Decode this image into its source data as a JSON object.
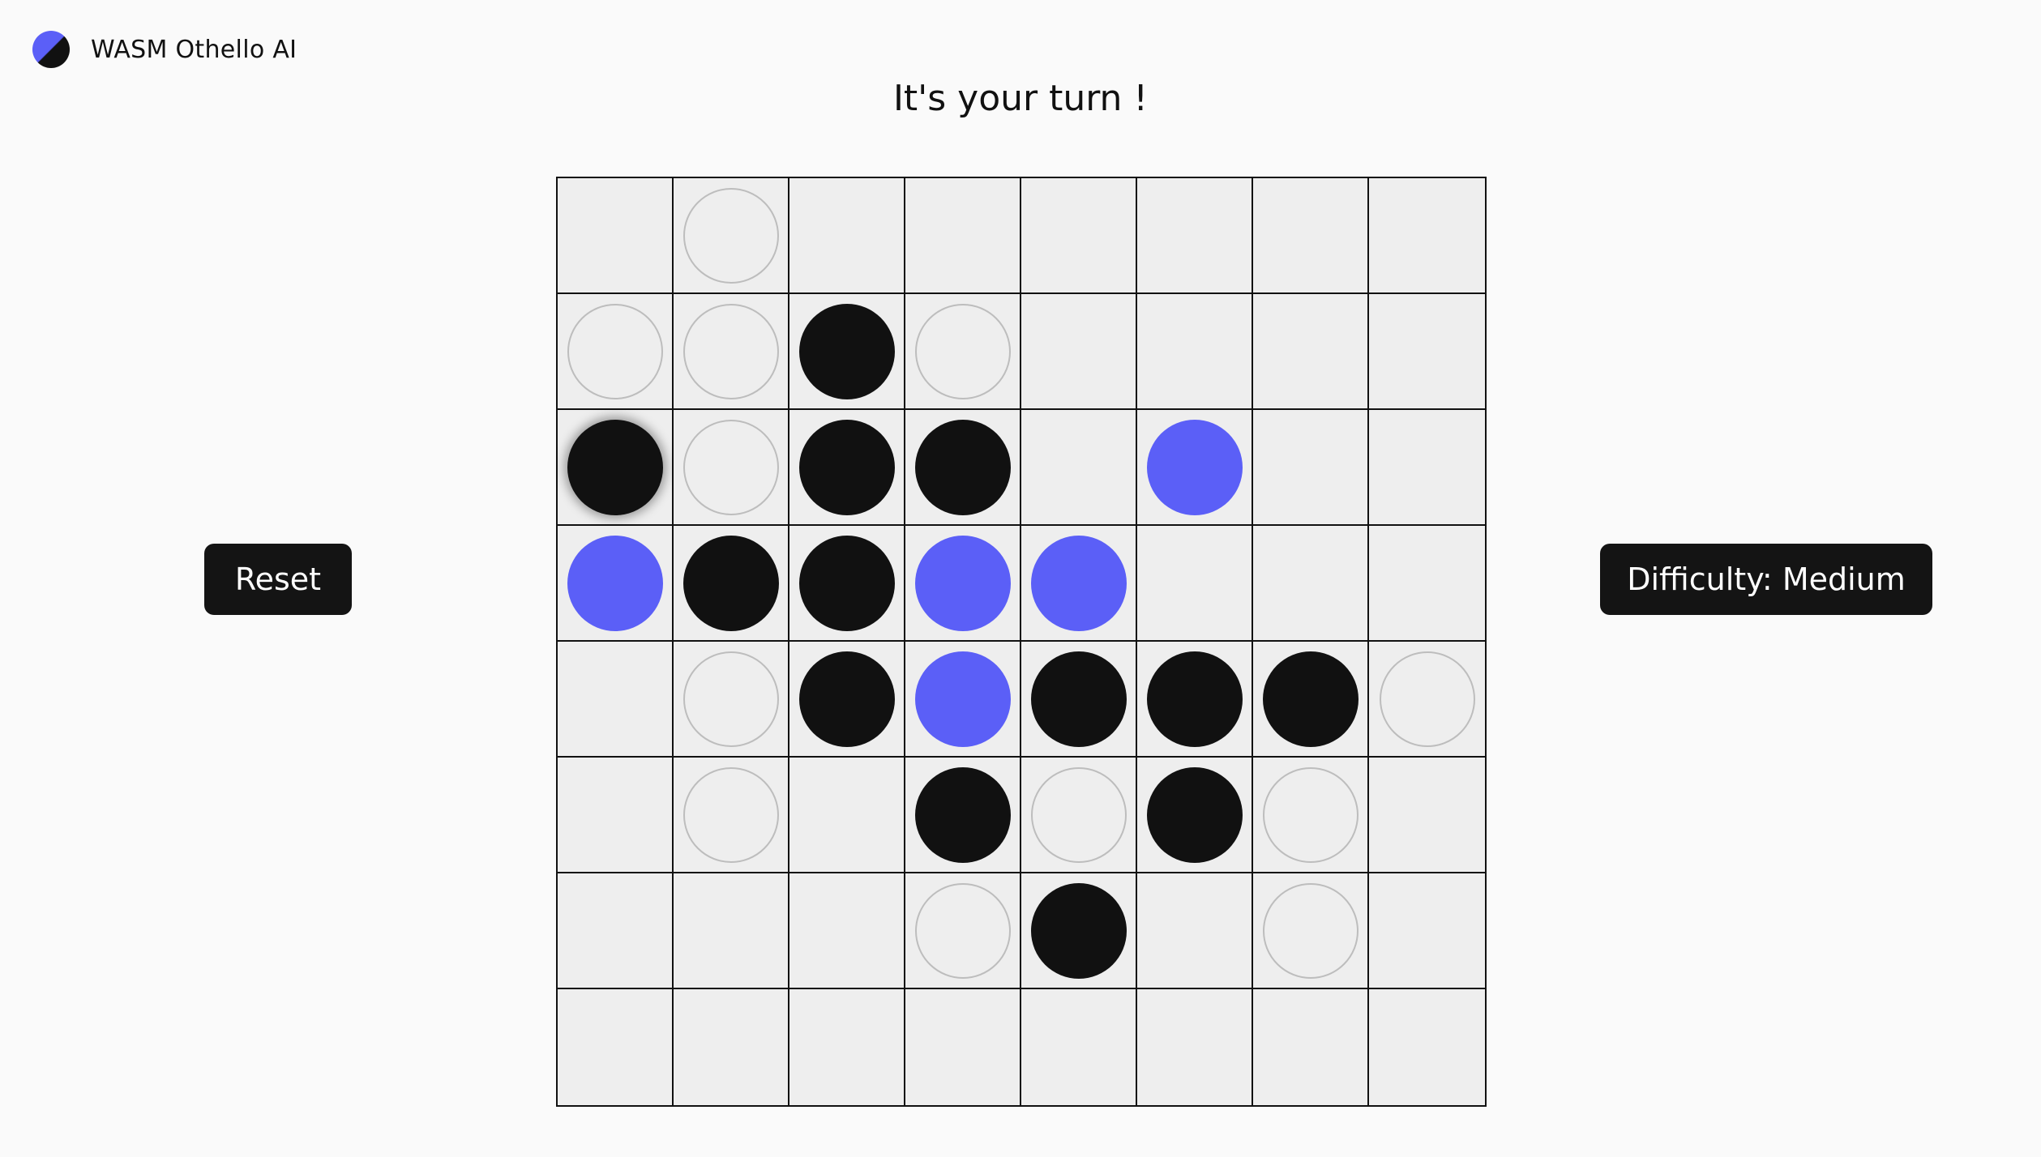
{
  "header": {
    "app_title": "WASM Othello AI",
    "logo_icon": "half-blue-half-black-disc-icon"
  },
  "status": {
    "message": "It's your turn !"
  },
  "controls": {
    "reset_label": "Reset",
    "difficulty_label": "Difficulty: Medium"
  },
  "colors": {
    "player_blue": "#5b5ff7",
    "opponent_black": "#111111",
    "board_cell": "#eeeeee",
    "hint_outline": "#bdbdbd"
  },
  "board": {
    "size": 8,
    "legend": {
      "B": "black",
      "P": "blue",
      "h": "valid-move-hint",
      ".": "empty",
      "L": "black-last-move"
    },
    "rows": [
      ".h......",
      "hhBh....",
      "LhBB.P..",
      "PBBPP...",
      ".hBPBBBh",
      ".h.BhBh.",
      "...hB.h.",
      "........"
    ]
  }
}
